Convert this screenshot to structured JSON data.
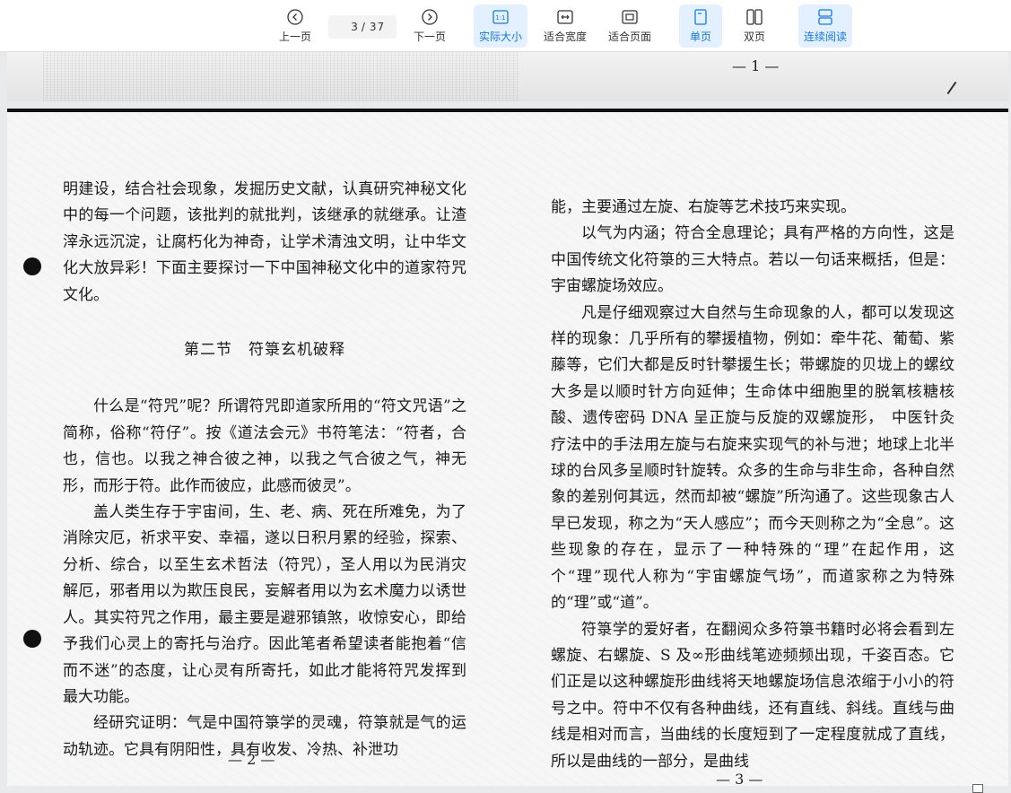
{
  "toolbar": {
    "prev_label": "上一页",
    "next_label": "下一页",
    "current_page": "3",
    "page_separator": "/",
    "total_pages": "37",
    "actual_size_icon_text": "1:1",
    "actual_size_label": "实际大小",
    "fit_width_label": "适合宽度",
    "fit_page_label": "适合页面",
    "single_page_label": "单页",
    "double_page_label": "双页",
    "continuous_label": "连续阅读",
    "accent_color": "#1677e8",
    "active_bg": "#e3f0ff"
  },
  "document": {
    "top_page_number": "— 1 —",
    "left_page": {
      "p1": "明建设，结合社会现象，发掘历史文献，认真研究神秘文化中的每一个问题，该批判的就批判，该继承的就继承。让渣滓永远沉淀，让腐朽化为神奇，让学术清浊文明，让中华文化大放异彩！下面主要探讨一下中国神秘文化中的道家符咒文化。",
      "section_title": "第二节　符箓玄机破释",
      "p2": "什么是“符咒”呢？所谓符咒即道家所用的“符文咒语”之简称，俗称“符仔”。按《道法会元》书符笔法：“符者，合也，信也。以我之神合彼之神，以我之气合彼之气，神无形，而形于符。此作而彼应，此感而彼灵”。",
      "p3": "盖人类生存于宇宙间，生、老、病、死在所难免，为了消除灾厄，祈求平安、幸福，遂以日积月累的经验，探索、分析、综合，以至生玄术哲法（符咒），圣人用以为民消灾解厄，邪者用以为欺压良民，妄解者用以为玄术魔力以诱世人。其实符咒之作用，最主要是避邪镇煞，收惊安心，即给予我们心灵上的寄托与治疗。因此笔者希望读者能抱着“信而不迷”的态度，让心灵有所寄托，如此才能将符咒发挥到最大功能。",
      "p4": "经研究证明：气是中国符箓学的灵魂，符箓就是气的运动轨迹。它具有阴阳性，具有收发、冷热、补泄功",
      "page_number": "— 2 —"
    },
    "right_page": {
      "p1": "能，主要通过左旋、右旋等艺术技巧来实现。",
      "p2": "以气为内涵；符合全息理论；具有严格的方向性，这是中国传统文化符箓的三大特点。若以一句话来概括，但是：宇宙螺旋场效应。",
      "p3": "凡是仔细观察过大自然与生命现象的人，都可以发现这样的现象：几乎所有的攀援植物，例如：牵牛花、葡萄、紫藤等，它们大都是反时针攀援生长；带螺旋的贝垅上的螺纹大多是以顺时针方向延伸；生命体中细胞里的脱氧核糖核酸、遗传密码 DNA 呈正旋与反旋的双螺旋形，　中医针灸疗法中的手法用左旋与右旋来实现气的补与泄；地球上北半球的台风多呈顺时针旋转。众多的生命与非生命，各种自然象的差别何其远，然而却被“螺旋”所沟通了。这些现象古人早已发现，称之为“天人感应”；而今天则称之为“全息”。这些现象的存在，显示了一种特殊的“理”在起作用，这个“理”现代人称为“宇宙螺旋气场”，而道家称之为特殊的“理”或“道”。",
      "p4": "符箓学的爱好者，在翻阅众多符箓书籍时必将会看到左螺旋、右螺旋、S 及∞形曲线笔迹频频出现，千姿百态。它们正是以这种螺旋形曲线将天地螺旋场信息浓缩于小小的符号之中。符中不仅有各种曲线，还有直线、斜线。直线与曲线是相对而言，当曲线的长度短到了一定程度就成了直线，所以是曲线的一部分，是曲线",
      "page_number": "— 3 —"
    }
  }
}
